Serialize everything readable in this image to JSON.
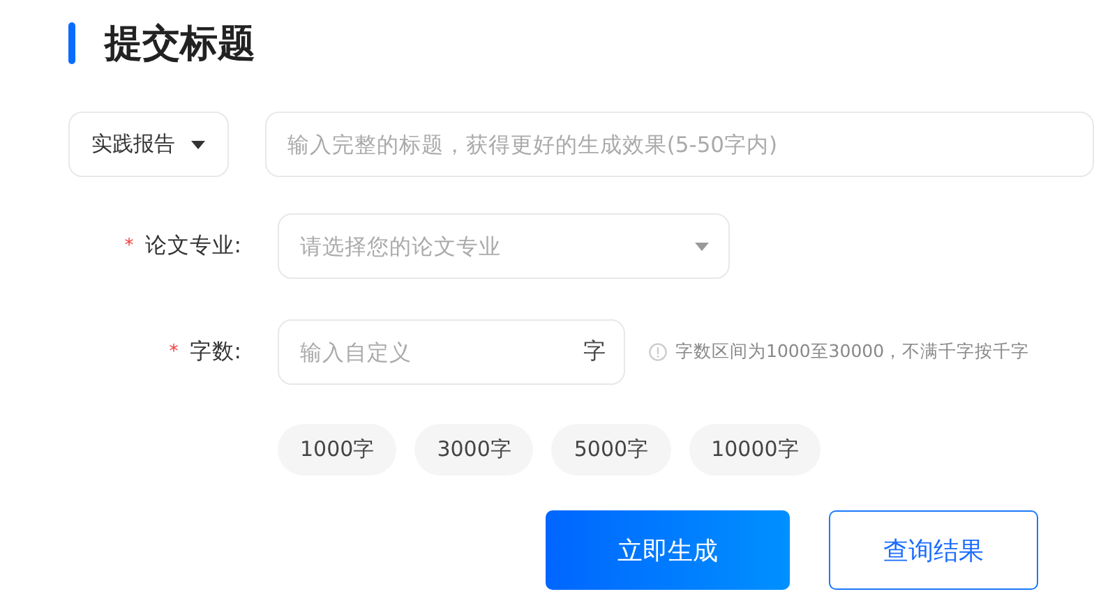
{
  "heading": "提交标题",
  "type_select": {
    "value": "实践报告"
  },
  "title_field": {
    "placeholder": "输入完整的标题，获得更好的生成效果(5-50字内)"
  },
  "fields": [
    {
      "kind": "select",
      "label": "论文专业:",
      "required_mark": "*",
      "placeholder": "请选择您的论文专业"
    },
    {
      "kind": "count",
      "label": "字数:",
      "required_mark": "*",
      "placeholder": "输入自定义",
      "unit": "字",
      "hint": "字数区间为1000至30000，不满千字按千字"
    }
  ],
  "presets": [
    "1000字",
    "3000字",
    "5000字",
    "10000字"
  ],
  "buttons": [
    {
      "label": "立即生成",
      "kind": "primary"
    },
    {
      "label": "查询结果",
      "kind": "outline"
    }
  ]
}
